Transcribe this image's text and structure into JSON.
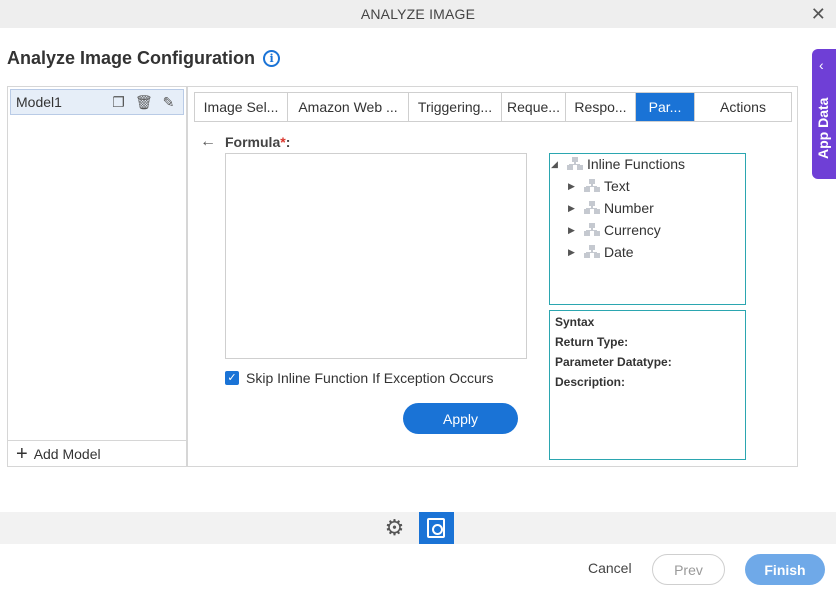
{
  "window": {
    "title": "ANALYZE IMAGE",
    "close_glyph": "✕"
  },
  "page": {
    "title": "Analyze Image Configuration",
    "info_glyph": "i"
  },
  "app_data": {
    "label": "App Data",
    "chevron": "‹"
  },
  "models": {
    "items": [
      {
        "label": "Model1"
      }
    ],
    "add_label": "Add Model",
    "add_glyph": "+",
    "actions": {
      "copy": "❐",
      "delete": "🗑",
      "edit": "✎"
    }
  },
  "tabs": [
    {
      "label": "Image Sel...",
      "active": false
    },
    {
      "label": "Amazon Web ...",
      "active": false
    },
    {
      "label": "Triggering...",
      "active": false
    },
    {
      "label": "Reque...",
      "active": false
    },
    {
      "label": "Respo...",
      "active": false
    },
    {
      "label": "Par...",
      "active": true
    },
    {
      "label": "Actions",
      "active": false
    }
  ],
  "formula": {
    "back_glyph": "←",
    "label": "Formula",
    "required_mark": "*",
    "colon": ":",
    "value": ""
  },
  "skip_option": {
    "label": "Skip Inline Function If Exception Occurs",
    "checked": true,
    "check_glyph": "✓"
  },
  "apply_label": "Apply",
  "function_tree": {
    "root": {
      "label": "Inline Functions",
      "toggle": "◢"
    },
    "children": [
      {
        "label": "Text",
        "toggle": "▶"
      },
      {
        "label": "Number",
        "toggle": "▶"
      },
      {
        "label": "Currency",
        "toggle": "▶"
      },
      {
        "label": "Date",
        "toggle": "▶"
      }
    ]
  },
  "syntax_panel": {
    "syntax": "Syntax",
    "return_type": "Return Type:",
    "parameter_datatype": "Parameter Datatype:",
    "description": "Description:"
  },
  "bottom_toolbar": {
    "gear_glyph": "⚙"
  },
  "footer": {
    "cancel": "Cancel",
    "prev": "Prev",
    "finish": "Finish"
  },
  "colors": {
    "accent": "#1a73d6",
    "app_data": "#6f3fd6",
    "finish_disabled": "#6fa9e8",
    "tree_border": "#2ba6b0"
  }
}
